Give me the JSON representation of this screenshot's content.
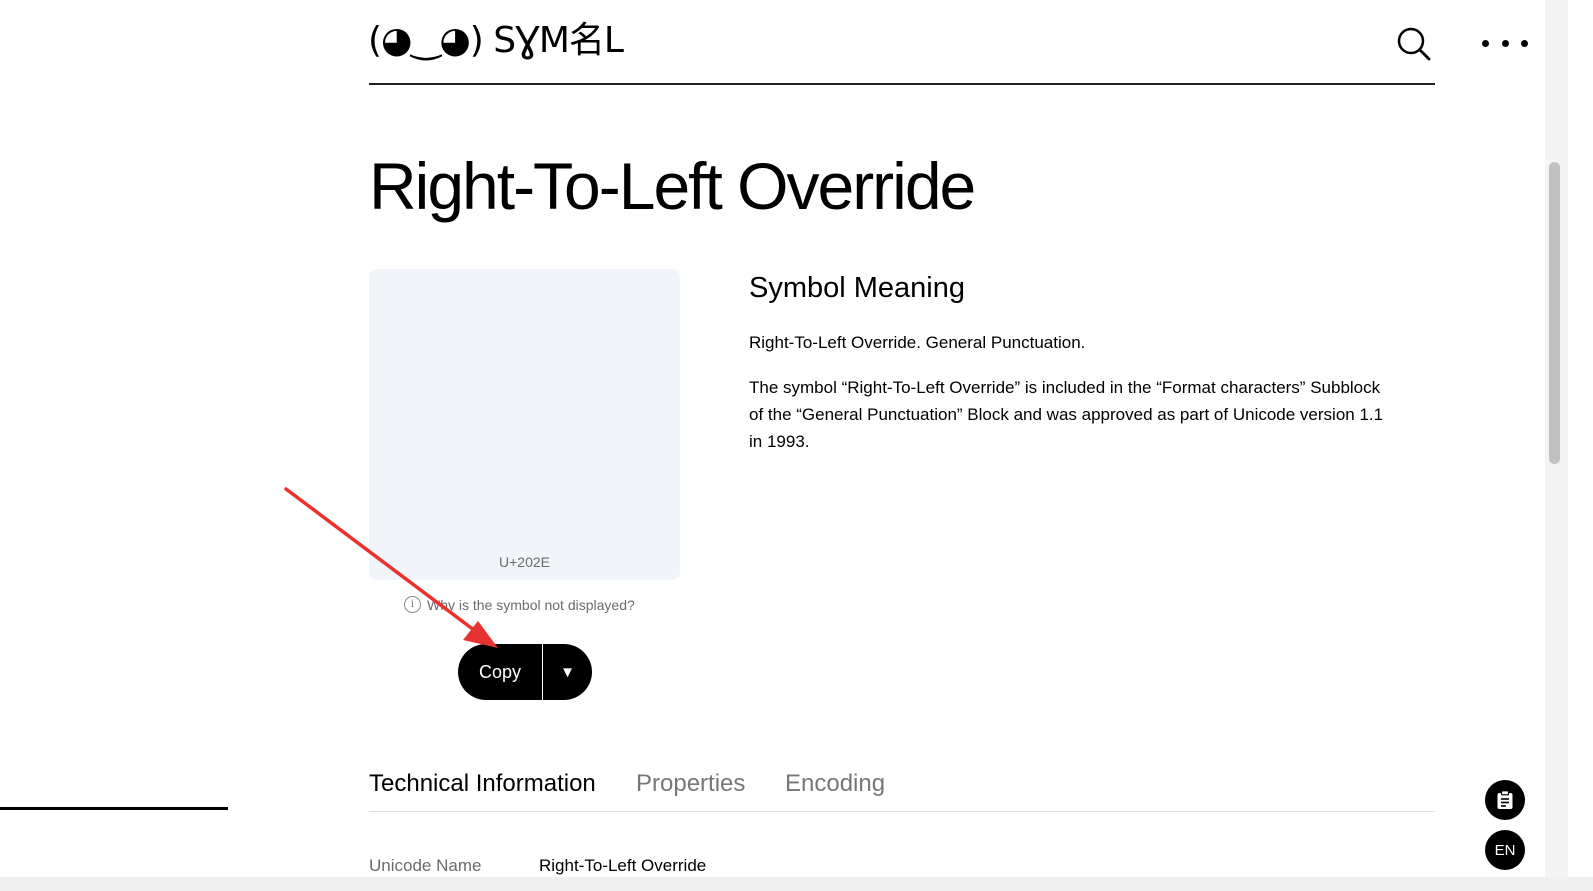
{
  "header": {
    "logo_text": "(◕‿◕) SƔM名L",
    "search_icon": "search-icon",
    "menu_icon": "more-dots-icon"
  },
  "page": {
    "title": "Right-To-Left Override"
  },
  "symbol": {
    "code": "U+202E",
    "why_link": "Why is the symbol not displayed?",
    "copy_label": "Copy",
    "dropdown_glyph": "▼"
  },
  "meaning": {
    "heading": "Symbol Meaning",
    "short": "Right-To-Left Override. General Punctuation.",
    "long": "The symbol “Right-To-Left Override” is included in the “Format characters” Subblock of the “General Punctuation” Block and was approved as part of Unicode version 1.1 in 1993."
  },
  "tabs": [
    {
      "label": "Technical Information",
      "active": true
    },
    {
      "label": "Properties",
      "active": false
    },
    {
      "label": "Encoding",
      "active": false
    }
  ],
  "tech_info": {
    "rows": [
      {
        "label": "Unicode Name",
        "value": "Right-To-Left Override"
      }
    ]
  },
  "floating": {
    "clipboard_icon": "clipboard-icon",
    "language": "EN"
  },
  "colors": {
    "accent": "#000000",
    "symbol_bg": "#f1f4f8",
    "annotation_arrow": "#e8322f"
  }
}
